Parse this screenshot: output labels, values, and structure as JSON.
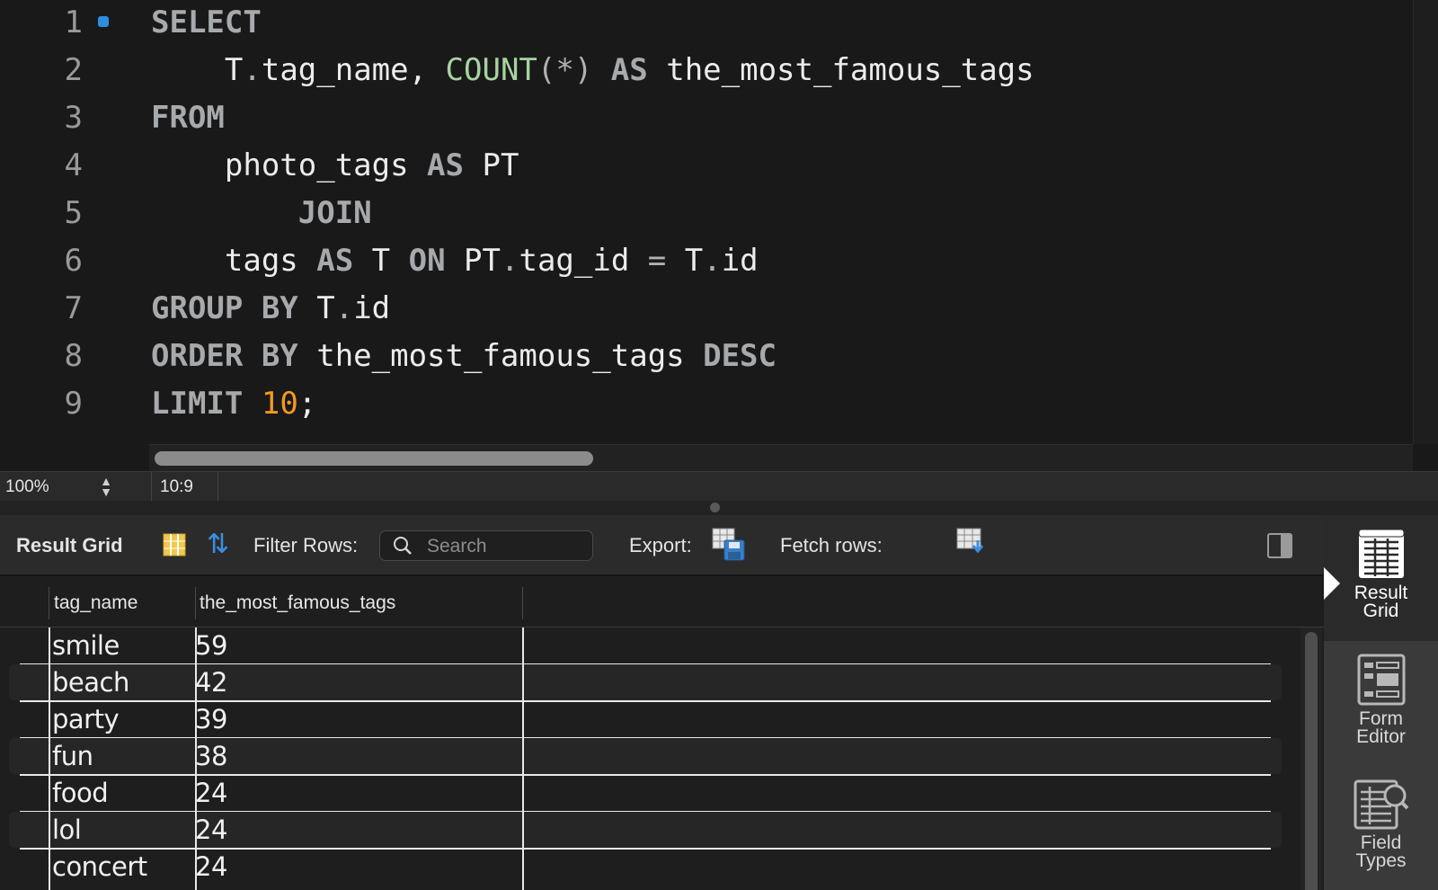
{
  "editor": {
    "line_numbers": [
      "1",
      "2",
      "3",
      "4",
      "5",
      "6",
      "7",
      "8",
      "9"
    ],
    "lines": [
      [
        {
          "t": "SELECT",
          "c": "kw"
        }
      ],
      [
        {
          "t": "    T",
          "c": ""
        },
        {
          "t": ".",
          "c": "op"
        },
        {
          "t": "tag_name, ",
          "c": ""
        },
        {
          "t": "COUNT",
          "c": "fn"
        },
        {
          "t": "(*)",
          "c": "op"
        },
        {
          "t": " AS ",
          "c": "kw"
        },
        {
          "t": "the_most_famous_tags",
          "c": ""
        }
      ],
      [
        {
          "t": "FROM",
          "c": "kw"
        }
      ],
      [
        {
          "t": "    photo_tags ",
          "c": ""
        },
        {
          "t": "AS",
          "c": "kw"
        },
        {
          "t": " PT",
          "c": ""
        }
      ],
      [
        {
          "t": "        JOIN",
          "c": "kw"
        }
      ],
      [
        {
          "t": "    tags ",
          "c": ""
        },
        {
          "t": "AS",
          "c": "kw"
        },
        {
          "t": " T ",
          "c": ""
        },
        {
          "t": "ON",
          "c": "kw"
        },
        {
          "t": " PT",
          "c": ""
        },
        {
          "t": ".",
          "c": "op"
        },
        {
          "t": "tag_id ",
          "c": ""
        },
        {
          "t": "=",
          "c": "op"
        },
        {
          "t": " T",
          "c": ""
        },
        {
          "t": ".",
          "c": "op"
        },
        {
          "t": "id",
          "c": ""
        }
      ],
      [
        {
          "t": "GROUP BY",
          "c": "kw"
        },
        {
          "t": " T",
          "c": ""
        },
        {
          "t": ".",
          "c": "op"
        },
        {
          "t": "id",
          "c": ""
        }
      ],
      [
        {
          "t": "ORDER BY",
          "c": "kw"
        },
        {
          "t": " the_most_famous_tags ",
          "c": ""
        },
        {
          "t": "DESC",
          "c": "kw"
        }
      ],
      [
        {
          "t": "LIMIT",
          "c": "kw"
        },
        {
          "t": " ",
          "c": ""
        },
        {
          "t": "10",
          "c": "num"
        },
        {
          "t": ";",
          "c": ""
        }
      ]
    ]
  },
  "statusbar": {
    "zoom": "100%",
    "cursor_position": "10:9"
  },
  "result_toolbar": {
    "title": "Result Grid",
    "filter_label": "Filter Rows:",
    "search_placeholder": "Search",
    "export_label": "Export:",
    "fetch_label": "Fetch rows:"
  },
  "grid": {
    "columns": [
      "tag_name",
      "the_most_famous_tags"
    ],
    "rows": [
      [
        "smile",
        "59"
      ],
      [
        "beach",
        "42"
      ],
      [
        "party",
        "39"
      ],
      [
        "fun",
        "38"
      ],
      [
        "food",
        "24"
      ],
      [
        "lol",
        "24"
      ],
      [
        "concert",
        "24"
      ]
    ]
  },
  "side_panel": {
    "items": [
      {
        "label_1": "Result",
        "label_2": "Grid",
        "icon": "result-grid-icon",
        "active": true
      },
      {
        "label_1": "Form",
        "label_2": "Editor",
        "icon": "form-editor-icon",
        "active": false
      },
      {
        "label_1": "Field",
        "label_2": "Types",
        "icon": "field-types-icon",
        "active": false
      }
    ]
  },
  "colors": {
    "keyword": "#a7aaad",
    "function": "#a8d3a2",
    "number": "#f29a1e",
    "breakpoint": "#2b8fe0",
    "refresh": "#3a8fe0"
  }
}
